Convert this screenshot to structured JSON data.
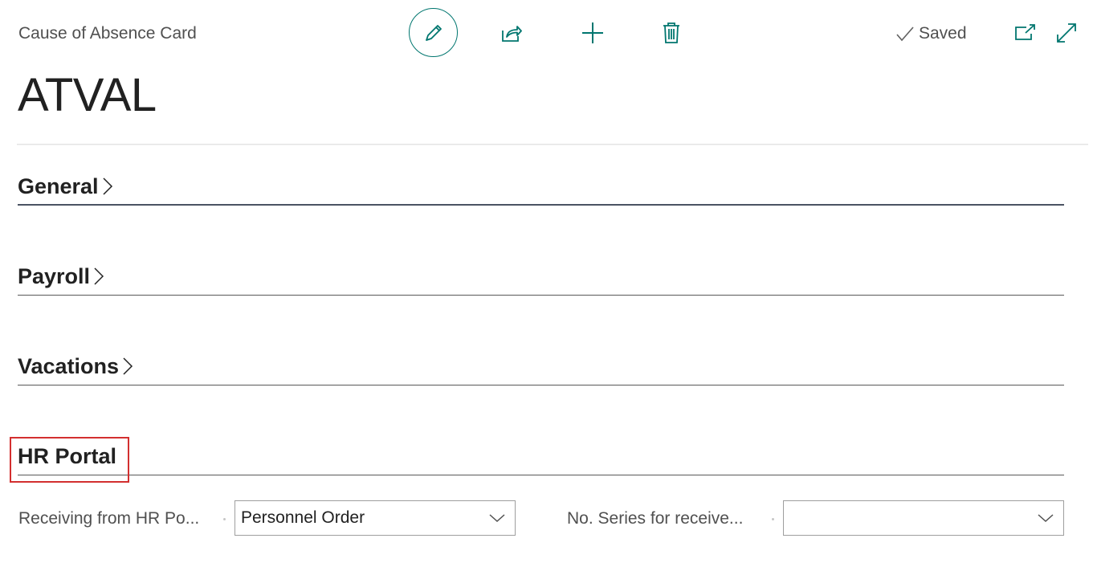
{
  "header": {
    "caption": "Cause of Absence Card",
    "record_title": "ATVAL",
    "status": "Saved",
    "icons": {
      "edit": "pencil-icon",
      "share": "share-icon",
      "new": "plus-icon",
      "delete": "trash-icon",
      "saved": "checkmark-icon",
      "open_new_window": "popout-icon",
      "expand": "expand-icon"
    },
    "accent_color": "#00766f"
  },
  "sections": [
    {
      "label": "General",
      "collapsed": true
    },
    {
      "label": "Payroll",
      "collapsed": true
    },
    {
      "label": "Vacations",
      "collapsed": true
    },
    {
      "label": "HR Portal",
      "collapsed": false,
      "highlighted": true
    }
  ],
  "hr_portal": {
    "receiving_label": "Receiving from HR Po...",
    "receiving_value": "Personnel Order",
    "no_series_label": "No. Series for receive...",
    "no_series_value": ""
  },
  "highlight_color": "#d32f2f"
}
